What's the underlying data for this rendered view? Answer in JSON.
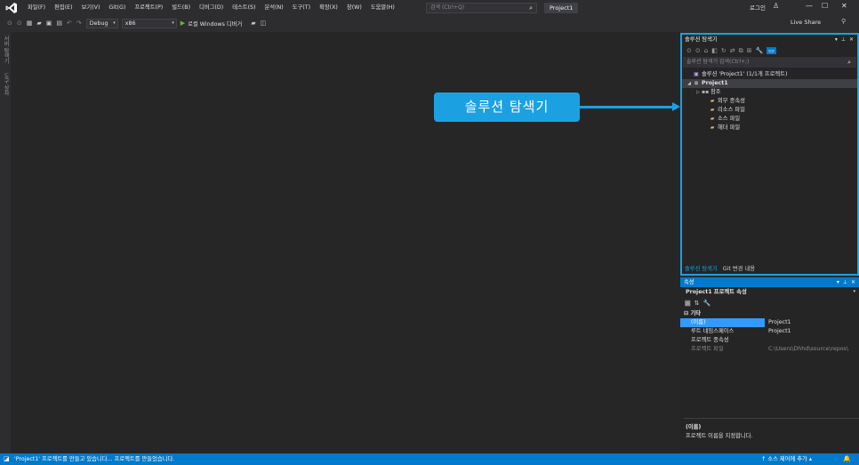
{
  "menu": [
    "파일(F)",
    "편집(E)",
    "보기(V)",
    "Git(G)",
    "프로젝트(P)",
    "빌드(B)",
    "디버그(D)",
    "테스트(S)",
    "분석(N)",
    "도구(T)",
    "확장(X)",
    "창(W)",
    "도움말(H)"
  ],
  "search": {
    "placeholder": "검색 (Ctrl+Q)"
  },
  "project_name": "Project1",
  "login_label": "로그인",
  "toolbar": {
    "config": "Debug",
    "platform": "x86",
    "run_label": "로컬 Windows 디버거",
    "live_share": "Live Share"
  },
  "left_tabs": [
    "서버 탐색기",
    "도구 상자"
  ],
  "solution_explorer": {
    "title": "솔루션 탐색기",
    "search_placeholder": "솔루션 탐색기 검색(Ctrl+;)",
    "tree": [
      {
        "label": "솔루션 'Project1' (1/1개 프로젝트)",
        "icon": "solution-icon"
      },
      {
        "label": "Project1",
        "icon": "project-icon"
      },
      {
        "label": "참조",
        "icon": "references-icon"
      },
      {
        "label": "외부 종속성",
        "icon": "folder-icon"
      },
      {
        "label": "리소스 파일",
        "icon": "folder-icon"
      },
      {
        "label": "소스 파일",
        "icon": "folder-icon"
      },
      {
        "label": "헤더 파일",
        "icon": "folder-icon"
      }
    ],
    "tabs": [
      "솔루션 탐색기",
      "Git 변경 내용"
    ]
  },
  "callout": "솔루션 탐색기",
  "properties": {
    "title": "속성",
    "object": "Project1 프로젝트 속성",
    "category": "기타",
    "rows": [
      {
        "name": "(이름)",
        "value": "Project1"
      },
      {
        "name": "루트 네임스페이스",
        "value": "Project1"
      },
      {
        "name": "프로젝트 종속성",
        "value": ""
      },
      {
        "name": "프로젝트 파일",
        "value": "C:\\Users\\Dhhd\\source\\repos\\"
      }
    ],
    "desc_title": "(이름)",
    "desc_text": "프로젝트 이름을 지정합니다."
  },
  "status": {
    "message": "'Project1' 프로젝트를 만들고 있습니다... 프로젝트를 만들었습니다.",
    "source_control": "소스 제어에 추가"
  },
  "colors": {
    "accent": "#007acc",
    "highlight": "#1ba1e2",
    "background": "#2d2d30"
  }
}
